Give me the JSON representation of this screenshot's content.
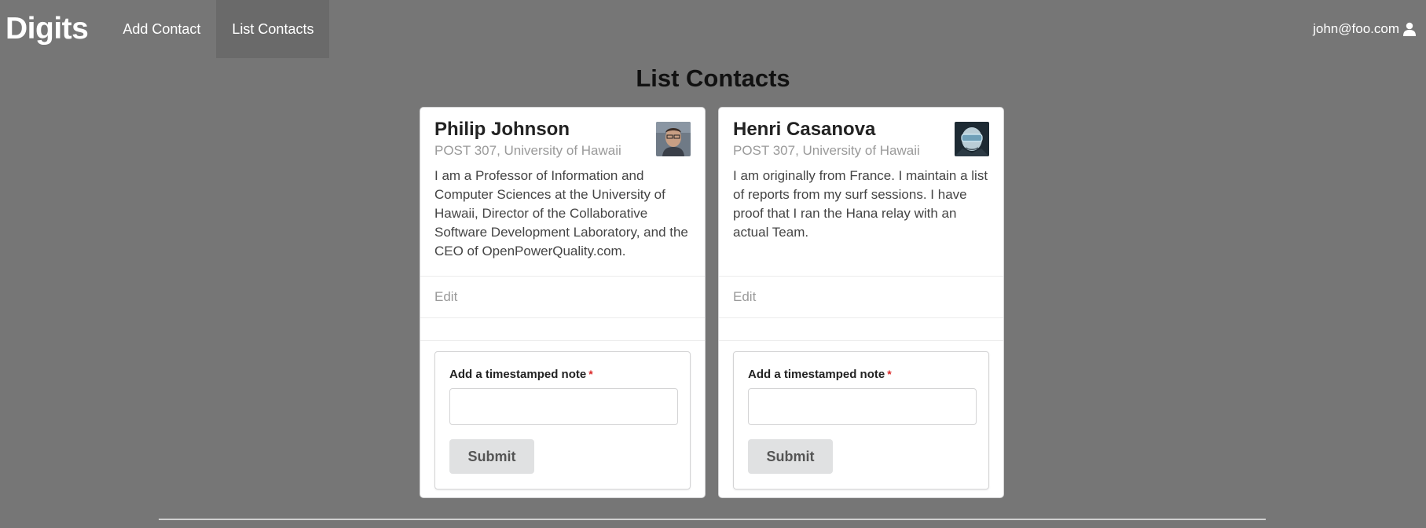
{
  "navbar": {
    "brand": "Digits",
    "items": [
      {
        "label": "Add Contact",
        "active": false
      },
      {
        "label": "List Contacts",
        "active": true
      }
    ],
    "user_email": "john@foo.com",
    "user_icon": "user-icon"
  },
  "page": {
    "title": "List Contacts"
  },
  "contacts": [
    {
      "name": "Philip Johnson",
      "address": "POST 307, University of Hawaii",
      "description": "I am a Professor of Information and Computer Sciences at the University of Hawaii, Director of the Collaborative Software Development Laboratory, and the CEO of OpenPowerQuality.com.",
      "edit_label": "Edit",
      "note_label": "Add a timestamped note",
      "note_required_mark": "*",
      "note_value": "",
      "submit_label": "Submit"
    },
    {
      "name": "Henri Casanova",
      "address": "POST 307, University of Hawaii",
      "description": "I am originally from France. I maintain a list of reports from my surf sessions. I have proof that I ran the Hana relay with an actual Team.",
      "edit_label": "Edit",
      "note_label": "Add a timestamped note",
      "note_required_mark": "*",
      "note_value": "",
      "submit_label": "Submit"
    }
  ],
  "colors": {
    "background": "#767676",
    "active_nav": "#6a6a6a",
    "required": "#db2828",
    "button": "#e0e1e2"
  }
}
